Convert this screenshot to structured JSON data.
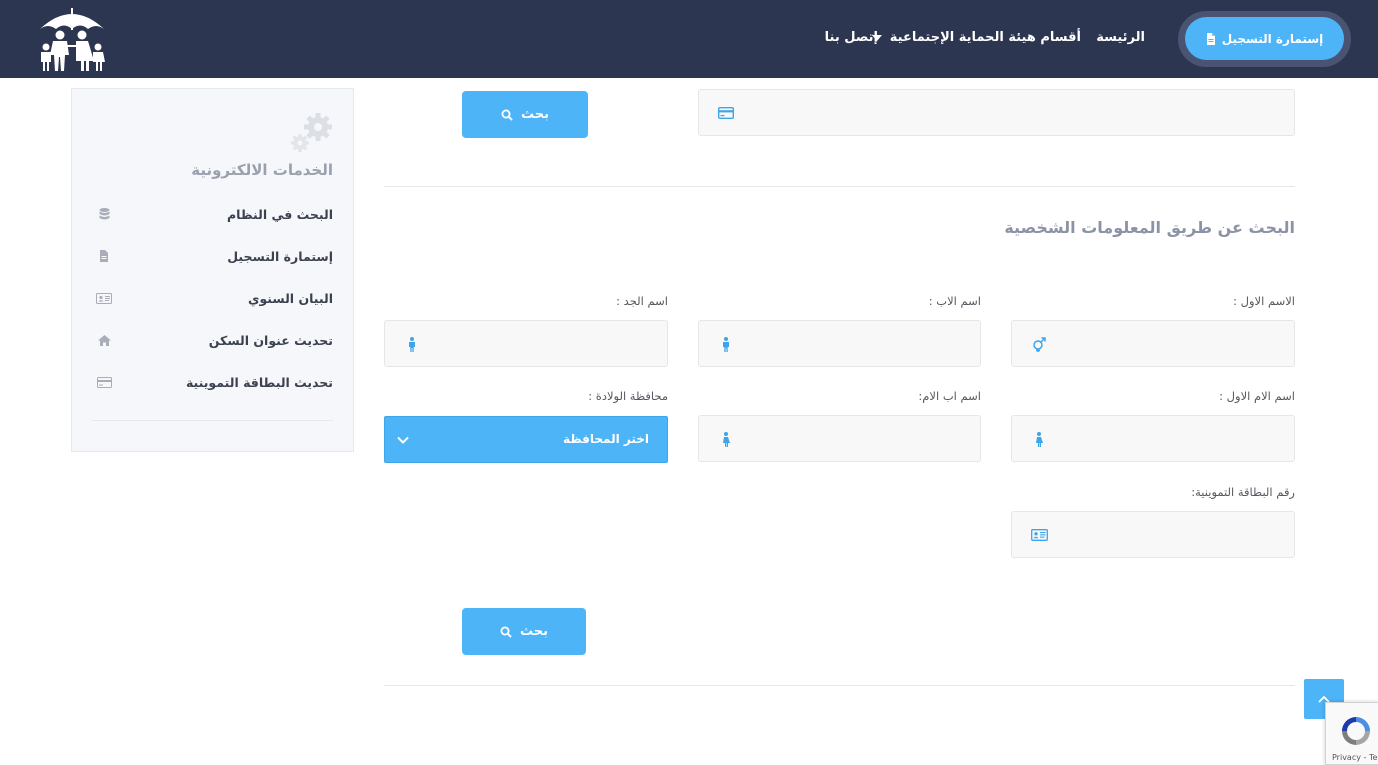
{
  "nav": {
    "register_button": "إستمارة التسجيل",
    "links": [
      "الرئيسة",
      "أقسام هيئة الحماية الإجتماعية",
      "إتصل بنا"
    ]
  },
  "sidebar": {
    "title": "الخدمات الالكترونية",
    "items": [
      {
        "label": "البحث في النظام",
        "icon": "database-icon"
      },
      {
        "label": "إستمارة التسجيل",
        "icon": "file-icon"
      },
      {
        "label": "البيان السنوي",
        "icon": "id-card-icon"
      },
      {
        "label": "تحديث عنوان السكن",
        "icon": "home-icon"
      },
      {
        "label": "تحديث البطاقة التموينية",
        "icon": "credit-card-icon"
      }
    ]
  },
  "top_search": {
    "card_value": "",
    "search_label": "بحث"
  },
  "personal_search": {
    "section_title": "البحث عن طريق المعلومات الشخصية",
    "first_name_label": "الاسم الاول :",
    "father_name_label": "اسم الاب :",
    "grandfather_name_label": "اسم الجد :",
    "mother_first_name_label": "اسم الام الاول :",
    "mother_father_name_label": "اسم اب الام:",
    "birth_province_label": "محافظة الولادة :",
    "birth_province_selected": "اختر المحافظة",
    "ration_card_label": "رقم البطاقة التموينية:",
    "first_name_value": "",
    "father_name_value": "",
    "grandfather_name_value": "",
    "mother_first_name_value": "",
    "mother_father_name_value": "",
    "ration_card_value": "",
    "search_label": "بحث"
  },
  "recaptcha": {
    "footer_text": "Privacy - Terms"
  },
  "colors": {
    "navbar": "#2d3650",
    "accent": "#4db4f7",
    "sidebar_bg": "#f5f7fb"
  }
}
